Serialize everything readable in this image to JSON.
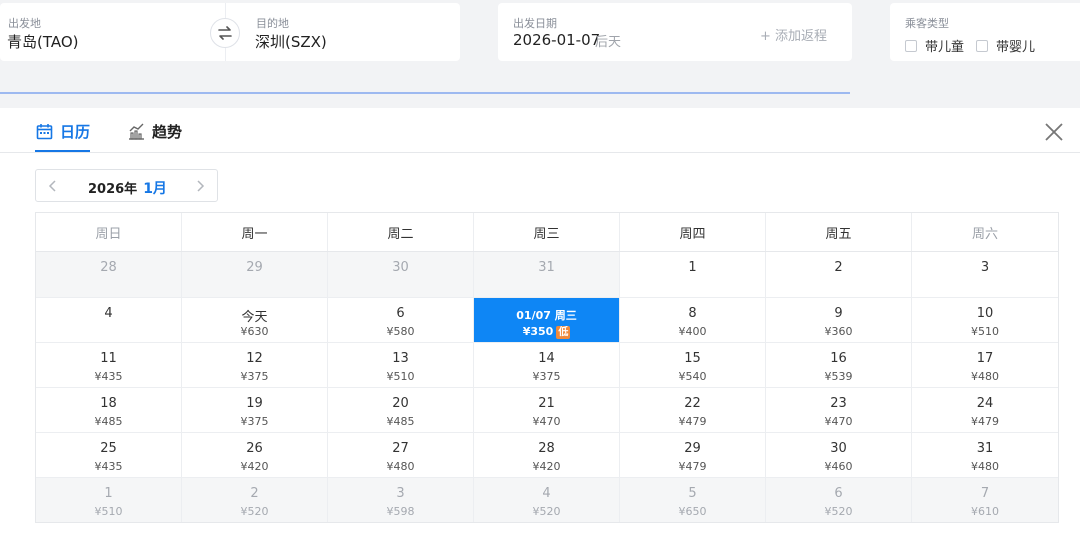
{
  "search": {
    "origin_label": "出发地",
    "origin_value": "青岛(TAO)",
    "dest_label": "目的地",
    "dest_value": "深圳(SZX)",
    "date_label": "出发日期",
    "date_value": "2026-01-07",
    "date_hint": "后天",
    "add_return": "+ 添加返程",
    "pax_label": "乘客类型",
    "pax_child": "带儿童",
    "pax_infant": "带婴儿"
  },
  "calendar": {
    "tab_calendar": "日历",
    "tab_trend": "趋势",
    "year_label": "2026年",
    "month_label": "1月",
    "weekdays": [
      "周日",
      "周一",
      "周二",
      "周三",
      "周四",
      "周五",
      "周六"
    ],
    "rows": [
      [
        {
          "day": "28",
          "price": "",
          "state": "out"
        },
        {
          "day": "29",
          "price": "",
          "state": "out"
        },
        {
          "day": "30",
          "price": "",
          "state": "out"
        },
        {
          "day": "31",
          "price": "",
          "state": "out"
        },
        {
          "day": "1",
          "price": "",
          "state": "in"
        },
        {
          "day": "2",
          "price": "",
          "state": "in"
        },
        {
          "day": "3",
          "price": "",
          "state": "in"
        }
      ],
      [
        {
          "day": "4",
          "price": "",
          "state": "in"
        },
        {
          "day": "今天",
          "price": "¥630",
          "state": "in"
        },
        {
          "day": "6",
          "price": "¥580",
          "state": "in"
        },
        {
          "day": "01/07 周三",
          "price": "¥350",
          "state": "selected",
          "badge": "低"
        },
        {
          "day": "8",
          "price": "¥400",
          "state": "in"
        },
        {
          "day": "9",
          "price": "¥360",
          "state": "in"
        },
        {
          "day": "10",
          "price": "¥510",
          "state": "in"
        }
      ],
      [
        {
          "day": "11",
          "price": "¥435",
          "state": "in"
        },
        {
          "day": "12",
          "price": "¥375",
          "state": "in"
        },
        {
          "day": "13",
          "price": "¥510",
          "state": "in"
        },
        {
          "day": "14",
          "price": "¥375",
          "state": "in"
        },
        {
          "day": "15",
          "price": "¥540",
          "state": "in"
        },
        {
          "day": "16",
          "price": "¥539",
          "state": "in"
        },
        {
          "day": "17",
          "price": "¥480",
          "state": "in"
        }
      ],
      [
        {
          "day": "18",
          "price": "¥485",
          "state": "in"
        },
        {
          "day": "19",
          "price": "¥375",
          "state": "in"
        },
        {
          "day": "20",
          "price": "¥485",
          "state": "in"
        },
        {
          "day": "21",
          "price": "¥470",
          "state": "in"
        },
        {
          "day": "22",
          "price": "¥479",
          "state": "in"
        },
        {
          "day": "23",
          "price": "¥470",
          "state": "in"
        },
        {
          "day": "24",
          "price": "¥479",
          "state": "in"
        }
      ],
      [
        {
          "day": "25",
          "price": "¥435",
          "state": "in"
        },
        {
          "day": "26",
          "price": "¥420",
          "state": "in"
        },
        {
          "day": "27",
          "price": "¥480",
          "state": "in"
        },
        {
          "day": "28",
          "price": "¥420",
          "state": "in"
        },
        {
          "day": "29",
          "price": "¥479",
          "state": "in"
        },
        {
          "day": "30",
          "price": "¥460",
          "state": "in"
        },
        {
          "day": "31",
          "price": "¥480",
          "state": "in"
        }
      ],
      [
        {
          "day": "1",
          "price": "¥510",
          "state": "out"
        },
        {
          "day": "2",
          "price": "¥520",
          "state": "out"
        },
        {
          "day": "3",
          "price": "¥598",
          "state": "out"
        },
        {
          "day": "4",
          "price": "¥520",
          "state": "out"
        },
        {
          "day": "5",
          "price": "¥650",
          "state": "out"
        },
        {
          "day": "6",
          "price": "¥520",
          "state": "out"
        },
        {
          "day": "7",
          "price": "¥610",
          "state": "out"
        }
      ]
    ]
  },
  "colors": {
    "accent": "#1677e5",
    "selected_bg": "#0e86f5",
    "low_badge": "#f08a3c"
  }
}
